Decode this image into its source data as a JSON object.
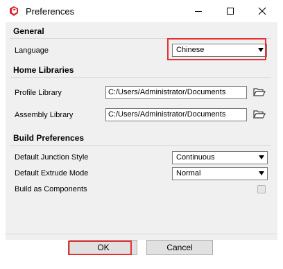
{
  "window": {
    "title": "Preferences"
  },
  "general": {
    "heading": "General",
    "language_label": "Language",
    "language_value": "Chinese"
  },
  "home_libraries": {
    "heading": "Home Libraries",
    "profile_label": "Profile Library",
    "profile_path": "C:/Users/Administrator/Documents",
    "assembly_label": "Assembly Library",
    "assembly_path": "C:/Users/Administrator/Documents"
  },
  "build": {
    "heading": "Build Preferences",
    "junction_label": "Default Junction Style",
    "junction_value": "Continuous",
    "extrude_label": "Default Extrude Mode",
    "extrude_value": "Normal",
    "components_label": "Build as Components",
    "components_checked": false
  },
  "buttons": {
    "ok": "OK",
    "cancel": "Cancel"
  },
  "colors": {
    "accent_highlight": "#e83030",
    "app_icon": "#d9262b"
  },
  "icons": {
    "app": "sketchup-logo-icon",
    "folder": "folder-open-icon"
  }
}
